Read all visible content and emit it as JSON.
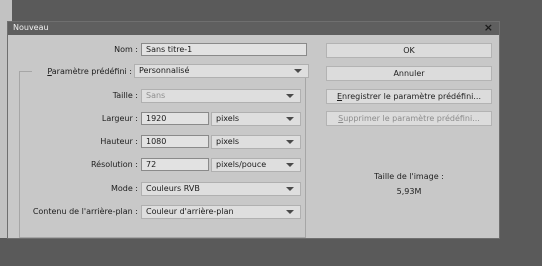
{
  "dialog": {
    "title": "Nouveau"
  },
  "form": {
    "nom": {
      "label": "Nom :",
      "value": "Sans titre-1"
    },
    "preset": {
      "label_u": "P",
      "label_rest": "aramètre prédéfini :",
      "value": "Personnalisé"
    },
    "taille": {
      "label": "Taille :",
      "value": "Sans"
    },
    "largeur": {
      "label": "Largeur :",
      "value": "1920",
      "unit": "pixels"
    },
    "hauteur": {
      "label": "Hauteur :",
      "value": "1080",
      "unit": "pixels"
    },
    "resolution": {
      "label": "Résolution :",
      "value": "72",
      "unit": "pixels/pouce"
    },
    "mode": {
      "label": "Mode :",
      "value": "Couleurs RVB"
    },
    "background": {
      "label": "Contenu de l'arrière-plan :",
      "value": "Couleur d'arrière-plan"
    }
  },
  "buttons": {
    "ok": "OK",
    "cancel": "Annuler",
    "save_u": "E",
    "save_rest": "nregistrer le paramètre prédéfini...",
    "delete_u": "S",
    "delete_rest": "upprimer le paramètre prédéfini..."
  },
  "image_info": {
    "label": "Taille de l'image :",
    "size": "5,93M"
  }
}
